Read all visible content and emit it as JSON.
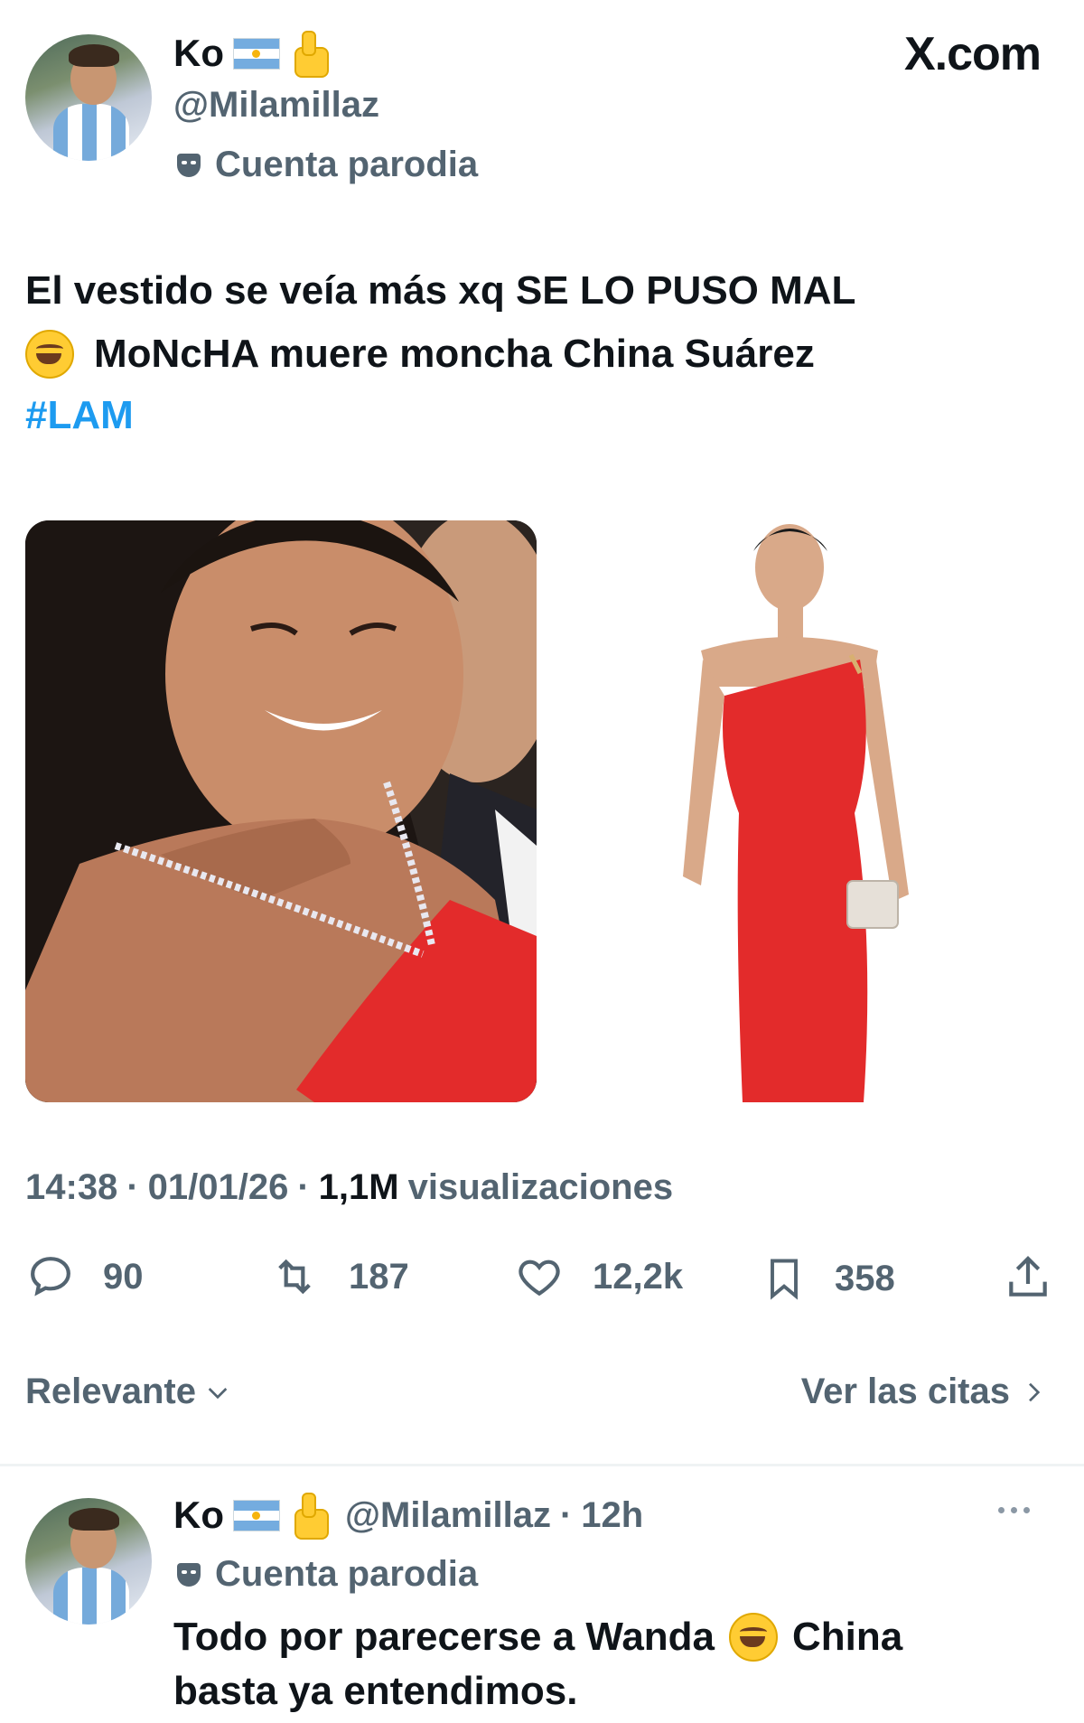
{
  "source_label": "X.com",
  "author": {
    "name": "Ko",
    "handle": "@Milamillaz",
    "badge": "Cuenta parodia"
  },
  "tweet": {
    "line1": "El vestido se veía más xq SE LO PUSO MAL",
    "line2": "MoNcHA muere moncha China Suárez",
    "hashtag": "#LAM",
    "time": "14:38",
    "date": "01/01/26",
    "views_count": "1,1M",
    "views_label": "visualizaciones",
    "sep": "·"
  },
  "actions": {
    "replies": "90",
    "retweets": "187",
    "likes": "12,2k",
    "bookmarks": "358"
  },
  "filters": {
    "sort_label": "Relevante",
    "quotes_label": "Ver las citas"
  },
  "reply": {
    "name": "Ko",
    "handle": "@Milamillaz",
    "time": "12h",
    "badge": "Cuenta parodia",
    "text_part1": "Todo por parecerse a Wanda",
    "text_part2": "China",
    "text_line2": "basta ya entendimos."
  },
  "colors": {
    "link_blue": "#1d9bf0",
    "muted": "#536471",
    "text": "#0f1419",
    "dress_red": "#e32b2b"
  }
}
